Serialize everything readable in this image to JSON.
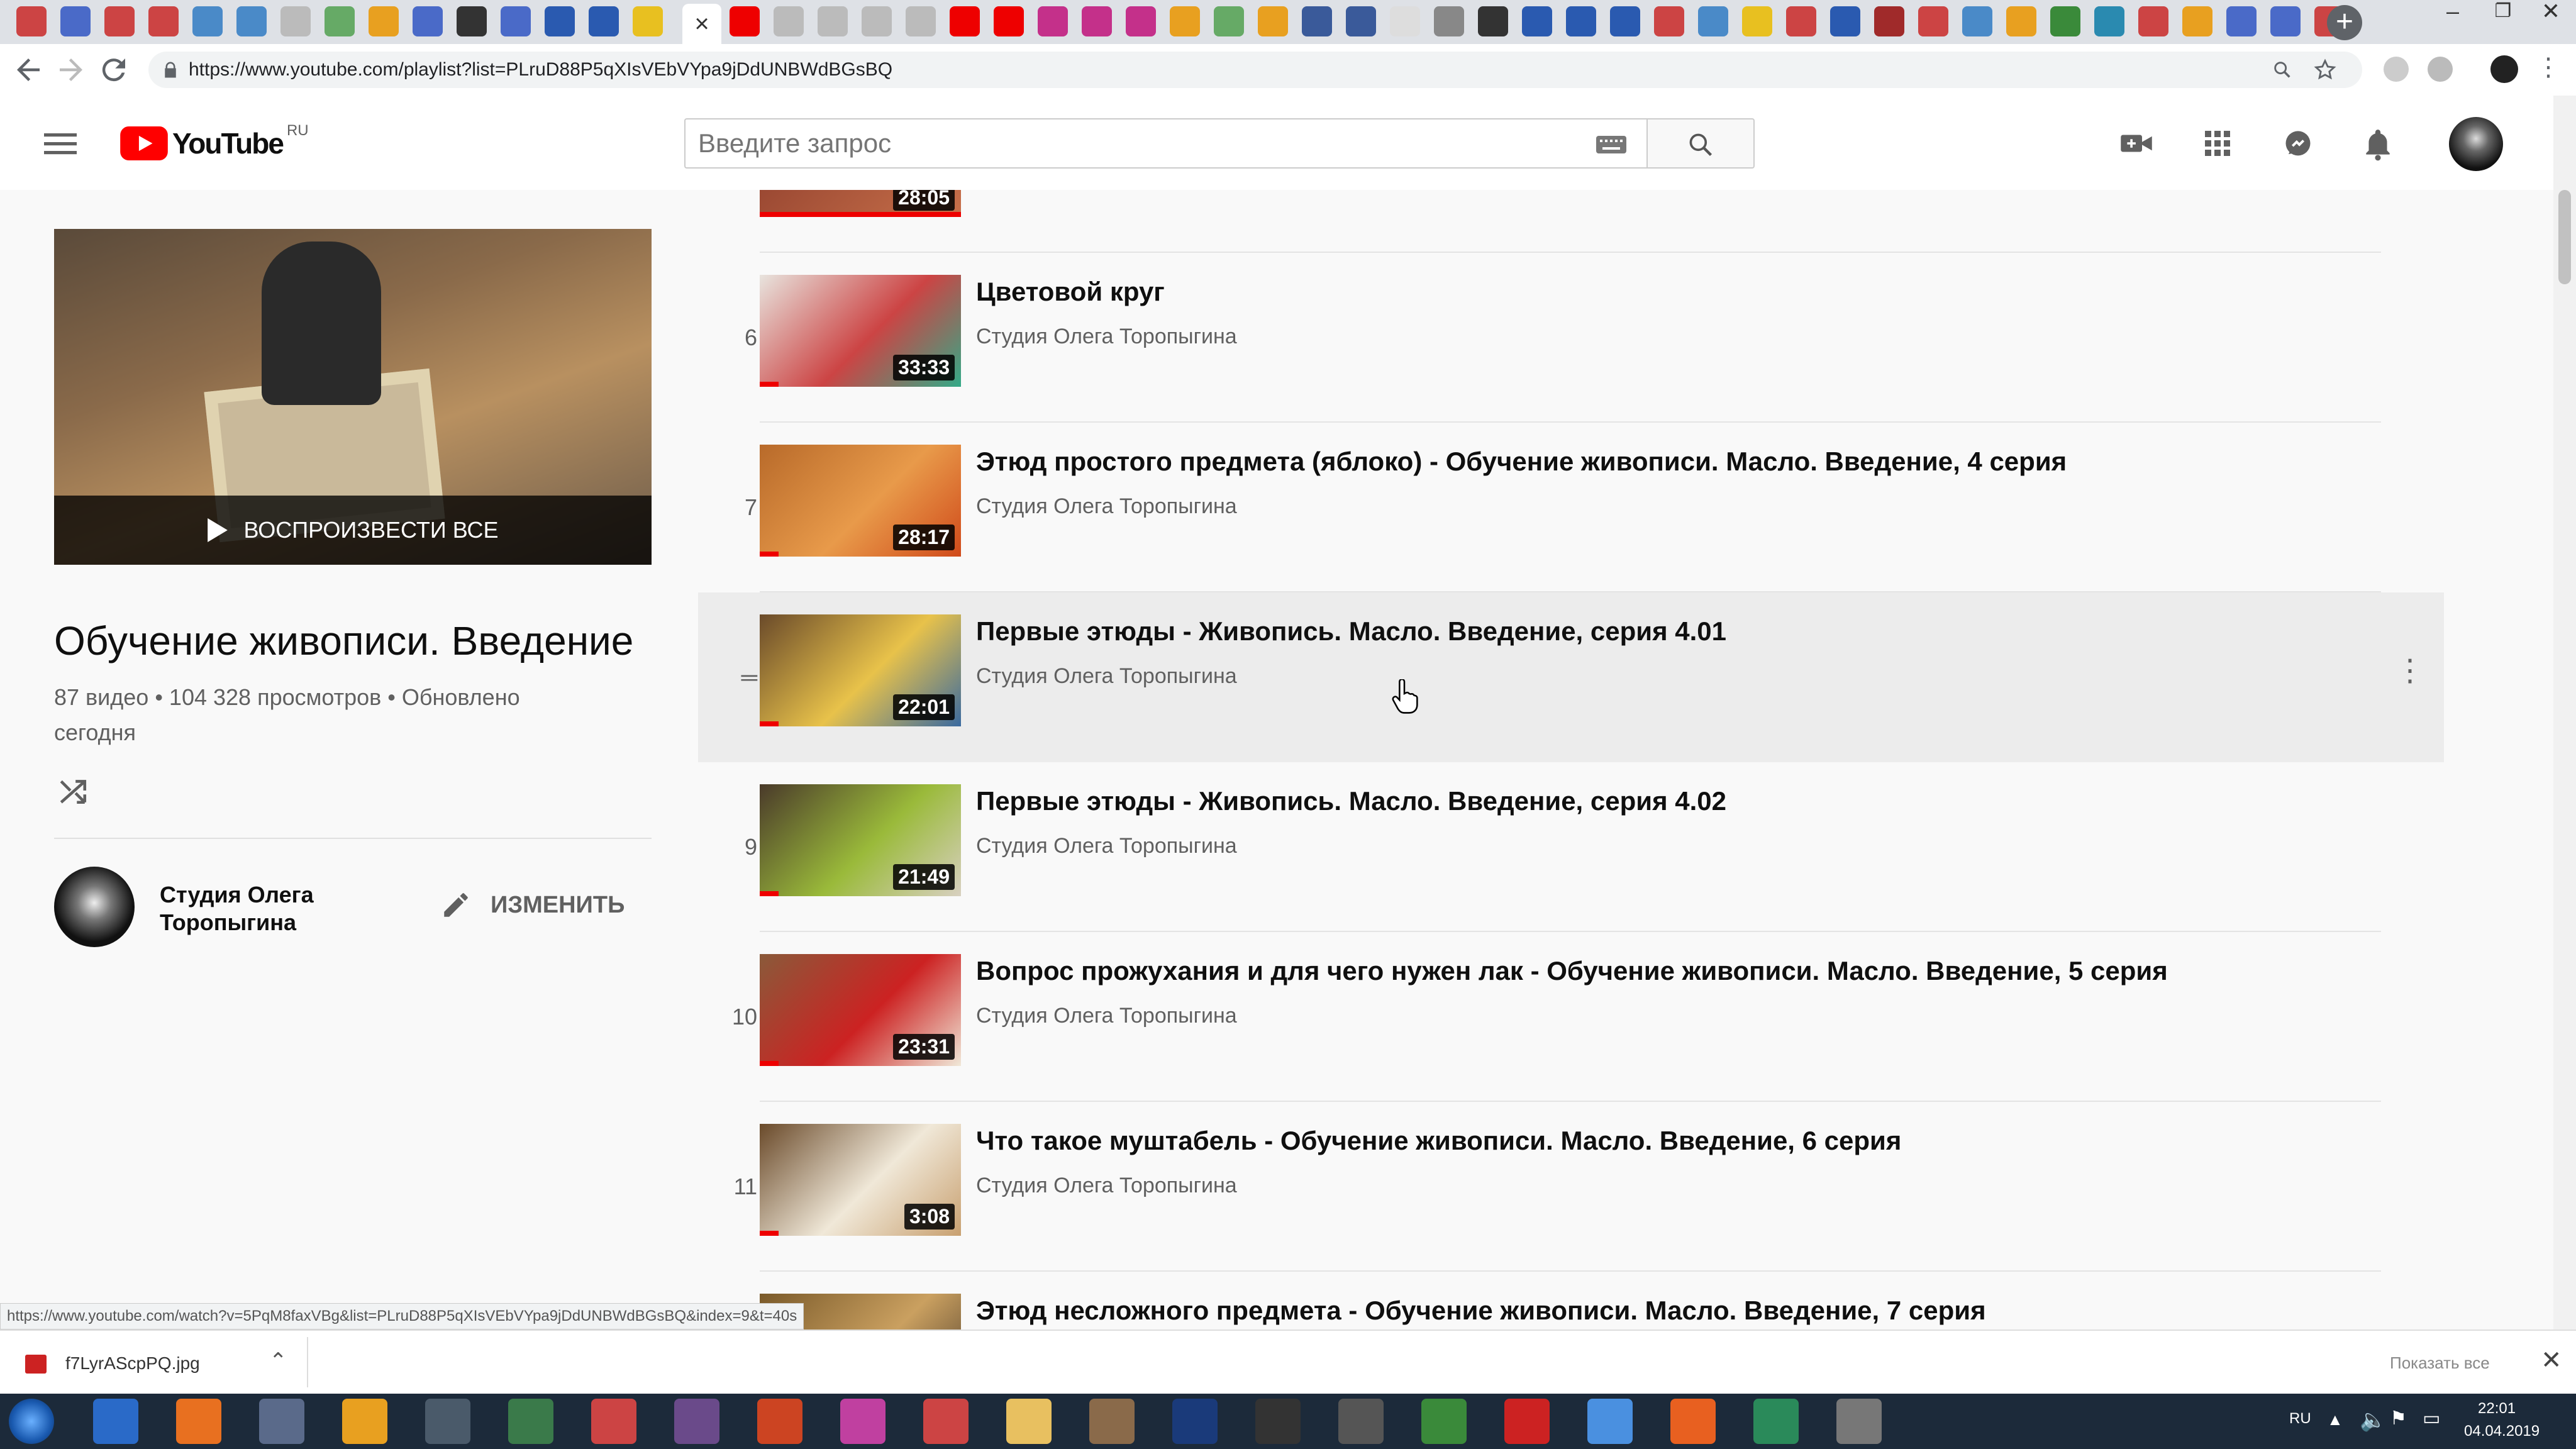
{
  "browser": {
    "url": "https://www.youtube.com/playlist?list=PLruD88P5qXIsVEbVYpa9jDdUNBWdBGsBQ",
    "status_url": "https://www.youtube.com/watch?v=5PqM8faxVBg&list=PLruD88P5qXIsVEbVYpa9jDdUNBWdBGsBQ&index=9&t=40s",
    "tab_close": "×",
    "newtab": "+",
    "window_controls": [
      "–",
      "❐",
      "✕"
    ]
  },
  "youtube": {
    "logo": "YouTube",
    "logo_region": "RU",
    "search_placeholder": "Введите запрос"
  },
  "sidebar": {
    "play_all_label": "ВОСПРОИЗВЕСТИ ВСЕ",
    "playlist_title": "Обучение живописи. Введение",
    "stats_line1": "87 видео • 104 328 просмотров • Обновлено",
    "stats_line2": "сегодня",
    "owner_name_line1": "Студия Олега",
    "owner_name_line2": "Торопыгина",
    "edit_label": "ИЗМЕНИТЬ"
  },
  "playlist": {
    "partial_duration": "28:05",
    "items": [
      {
        "index": "6",
        "title": "Цветовой круг",
        "channel": "Студия Олега Торопыгина",
        "duration": "33:33",
        "colors": [
          "#e8e4de",
          "#c44",
          "#3a8"
        ]
      },
      {
        "index": "7",
        "title": "Этюд простого предмета (яблоко) - Обучение живописи. Масло. Введение, 4 серия",
        "channel": "Студия Олега Торопыгина",
        "duration": "28:17",
        "colors": [
          "#b86a2a",
          "#e89a4a",
          "#d04a1a"
        ]
      },
      {
        "index": "",
        "title": "Первые этюды - Живопись. Масло. Введение, серия 4.01",
        "channel": "Студия Олега Торопыгина",
        "duration": "22:01",
        "colors": [
          "#6a4a2a",
          "#e8c24a",
          "#3a6aa0"
        ]
      },
      {
        "index": "9",
        "title": "Первые этюды - Живопись. Масло. Введение, серия 4.02",
        "channel": "Студия Олега Торопыгина",
        "duration": "21:49",
        "colors": [
          "#4a3a2a",
          "#9aba3a",
          "#d8d0c0"
        ]
      },
      {
        "index": "10",
        "title": "Вопрос прожухания и для чего нужен лак - Обучение живописи. Масло. Введение, 5 серия",
        "channel": "Студия Олега Торопыгина",
        "duration": "23:31",
        "colors": [
          "#8a5a3a",
          "#c22",
          "#f0e8d8"
        ]
      },
      {
        "index": "11",
        "title": "Что такое муштабель - Обучение живописи. Масло. Введение, 6 серия",
        "channel": "Студия Олега Торопыгина",
        "duration": "3:08",
        "colors": [
          "#6a4a2a",
          "#f0e8d8",
          "#c8a070"
        ]
      },
      {
        "index": "",
        "title": "Этюд несложного предмета - Обучение живописи. Масло. Введение, 7 серия",
        "channel": "",
        "duration": "",
        "colors": [
          "#7a5a2a",
          "#caa060",
          "#4a3a2a"
        ]
      }
    ]
  },
  "downloads": {
    "file_name": "f7LyrAScpPQ.jpg",
    "show_all": "Показать все"
  },
  "taskbar": {
    "lang": "RU",
    "time": "22:01",
    "date": "04.04.2019"
  }
}
